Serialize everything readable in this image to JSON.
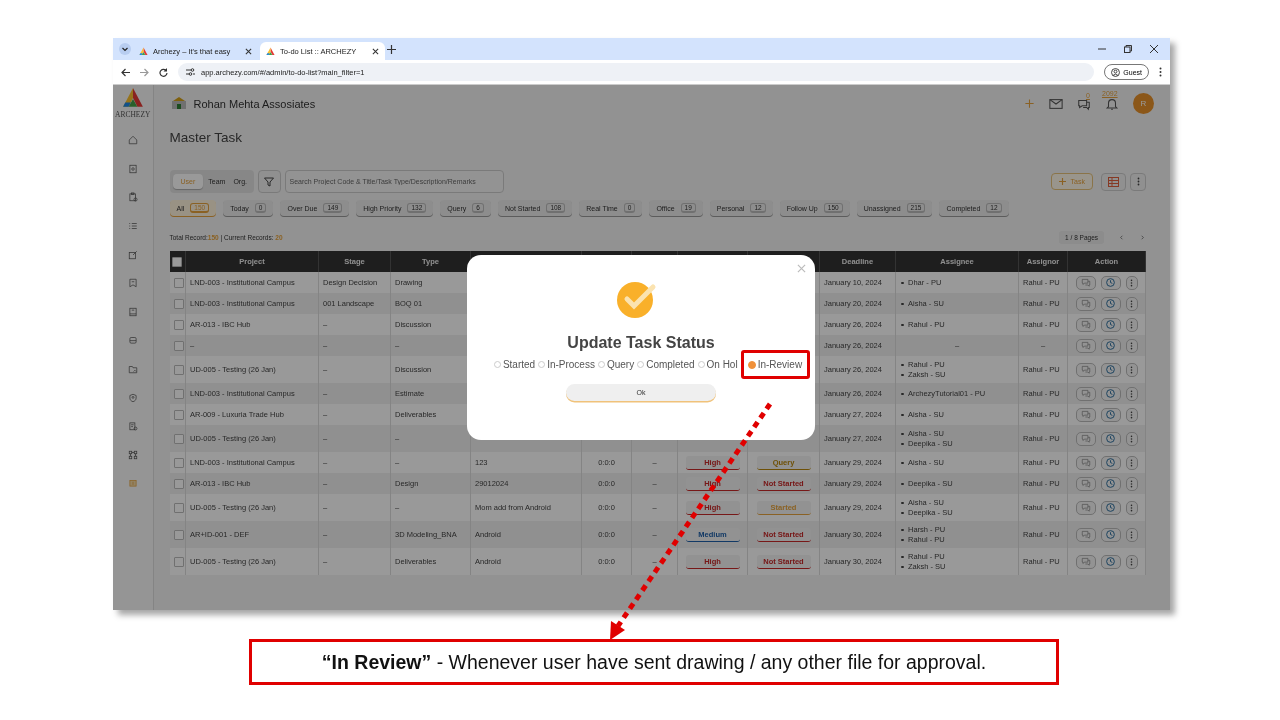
{
  "browser": {
    "tabs": [
      {
        "title": "Archezy – It's that easy",
        "selected": false
      },
      {
        "title": "To-do List :: ARCHEZY",
        "selected": true
      }
    ],
    "url": "app.archezy.com/#/admin/to-do-list?main_filter=1",
    "profile": "Guest"
  },
  "app": {
    "logo_text": "ARCHEZY",
    "org_name": "Rohan Mehta Assosiates",
    "page_title": "Master Task",
    "chat_count": "0",
    "notification_count": "2092",
    "avatar": "R"
  },
  "toolbar": {
    "view_toggle": [
      {
        "label": "User",
        "selected": true
      },
      {
        "label": "Team",
        "selected": false
      },
      {
        "label": "Org.",
        "selected": false
      }
    ],
    "search_placeholder": "Search Project Code & Title/Task Type/Description/Remarks",
    "add_button": "Task"
  },
  "filters": [
    {
      "label": "All",
      "count": "150",
      "selected": true
    },
    {
      "label": "Today",
      "count": "0",
      "selected": false
    },
    {
      "label": "Over Due",
      "count": "149",
      "selected": false
    },
    {
      "label": "High Priority",
      "count": "132",
      "selected": false
    },
    {
      "label": "Query",
      "count": "6",
      "selected": false
    },
    {
      "label": "Not Started",
      "count": "108",
      "selected": false
    },
    {
      "label": "Real Time",
      "count": "0",
      "selected": false
    },
    {
      "label": "Office",
      "count": "19",
      "selected": false
    },
    {
      "label": "Personal",
      "count": "12",
      "selected": false
    },
    {
      "label": "Follow Up",
      "count": "150",
      "selected": false
    },
    {
      "label": "Unassigned",
      "count": "215",
      "selected": false
    },
    {
      "label": "Completed",
      "count": "12",
      "selected": false
    }
  ],
  "records": {
    "total_label": "Total Record:",
    "total": "150",
    "current_label": " | Current Records: ",
    "current": "20",
    "pages": "1 / 8 Pages"
  },
  "table": {
    "select_all_checked": false,
    "columns": [
      "Project",
      "Stage",
      "Type",
      "Deadline",
      "Assignee",
      "Assignor",
      "Action"
    ],
    "rows": [
      {
        "checked": false,
        "project": "LND-003 - Institutional Campus",
        "stage": "Design Decision",
        "type": "Drawing",
        "deadline": "January 10, 2024",
        "assignees": [
          "Dhar - PU"
        ],
        "assignor": "Rahul - PU"
      },
      {
        "checked": false,
        "project": "LND-003 - Institutional Campus",
        "stage": "001 Landscape",
        "type": "BOQ 01",
        "deadline": "January 20, 2024",
        "assignees": [
          "Aisha - SU"
        ],
        "assignor": "Rahul - PU"
      },
      {
        "checked": false,
        "project": "AR-013 - IBC Hub",
        "stage": "–",
        "type": "Discussion",
        "deadline": "January 26, 2024",
        "assignees": [
          "Rahul - PU"
        ],
        "assignor": "Rahul - PU"
      },
      {
        "checked": false,
        "project": "–",
        "stage": "–",
        "type": "–",
        "deadline": "January 26, 2024",
        "assignee_text": "–",
        "assignor": "–"
      },
      {
        "checked": false,
        "project": "UD-005 - Testing (26 Jan)",
        "stage": "–",
        "type": "Discussion",
        "deadline": "January 26, 2024",
        "assignees": [
          "Rahul - PU",
          "Zaksh - SU"
        ],
        "assignor": "Rahul - PU"
      },
      {
        "checked": false,
        "project": "LND-003 - Institutional Campus",
        "stage": "–",
        "type": "Estimate",
        "deadline": "January 26, 2024",
        "assignees": [
          "ArchezyTutorial01 - PU"
        ],
        "assignor": "Rahul - PU"
      },
      {
        "checked": false,
        "project": "AR-009 - Luxuria Trade Hub",
        "stage": "–",
        "type": "Deliverables",
        "deadline": "January 27, 2024",
        "assignees": [
          "Aisha - SU"
        ],
        "assignor": "Rahul - PU"
      },
      {
        "checked": false,
        "project": "UD-005 - Testing (26 Jan)",
        "stage": "–",
        "type": "–",
        "deadline": "January 27, 2024",
        "assignees": [
          "Aisha - SU",
          "Deepika - SU"
        ],
        "assignor": "Rahul - PU"
      },
      {
        "checked": false,
        "project": "LND-003 - Institutional Campus",
        "stage": "–",
        "type": "–",
        "column_4": "123",
        "column_5": "0:0:0",
        "column_6": "–",
        "priority": {
          "label": "High",
          "kind": "high"
        },
        "status": {
          "label": "Query",
          "kind": "query"
        },
        "deadline": "January 29, 2024",
        "assignees": [
          "Aisha - SU"
        ],
        "assignor": "Rahul - PU"
      },
      {
        "checked": false,
        "project": "AR-013 - IBC Hub",
        "stage": "–",
        "type": "Design",
        "column_4": "29012024",
        "column_5": "0:0:0",
        "column_6": "–",
        "priority": {
          "label": "High",
          "kind": "high"
        },
        "status": {
          "label": "Not Started",
          "kind": "not_started"
        },
        "deadline": "January 29, 2024",
        "assignees": [
          "Deepika - SU"
        ],
        "assignor": "Rahul - PU"
      },
      {
        "checked": false,
        "project": "UD-005 - Testing (26 Jan)",
        "stage": "–",
        "type": "–",
        "column_4": "Mom add from Android",
        "column_5": "0:0:0",
        "column_6": "–",
        "priority": {
          "label": "High",
          "kind": "high"
        },
        "status": {
          "label": "Started",
          "kind": "started"
        },
        "deadline": "January 29, 2024",
        "assignees": [
          "Aisha - SU",
          "Deepika - SU"
        ],
        "assignor": "Rahul - PU"
      },
      {
        "checked": false,
        "project": "AR+ID-001 - DEF",
        "stage": "–",
        "type": "3D Modeling_BNA",
        "column_4": "Android",
        "column_5": "0:0:0",
        "column_6": "–",
        "priority": {
          "label": "Medium",
          "kind": "medium"
        },
        "status": {
          "label": "Not Started",
          "kind": "not_started"
        },
        "deadline": "January 30, 2024",
        "assignees": [
          "Harsh - PU",
          "Rahul - PU"
        ],
        "assignor": "Rahul - PU"
      },
      {
        "checked": false,
        "project": "UD-005 - Testing (26 Jan)",
        "stage": "–",
        "type": "Deliverables",
        "column_4": "Android",
        "column_5": "0:0:0",
        "column_6": "–",
        "priority": {
          "label": "High",
          "kind": "high"
        },
        "status": {
          "label": "Not Started",
          "kind": "not_started"
        },
        "deadline": "January 30, 2024",
        "assignees": [
          "Rahul - PU",
          "Zaksh - SU"
        ],
        "assignor": "Rahul - PU"
      }
    ]
  },
  "modal": {
    "title": "Update Task Status",
    "options": [
      {
        "label": "Started",
        "selected": false
      },
      {
        "label": "In-Process",
        "selected": false
      },
      {
        "label": "Query",
        "selected": false
      },
      {
        "label": "Completed",
        "selected": false
      },
      {
        "label": "On Hol",
        "selected": false
      },
      {
        "label": "In-Review",
        "selected": true
      }
    ],
    "ok_button": "Ok"
  },
  "callout": {
    "text": "**“In Review”** - Whenever user have sent drawing / any other file for approval."
  }
}
